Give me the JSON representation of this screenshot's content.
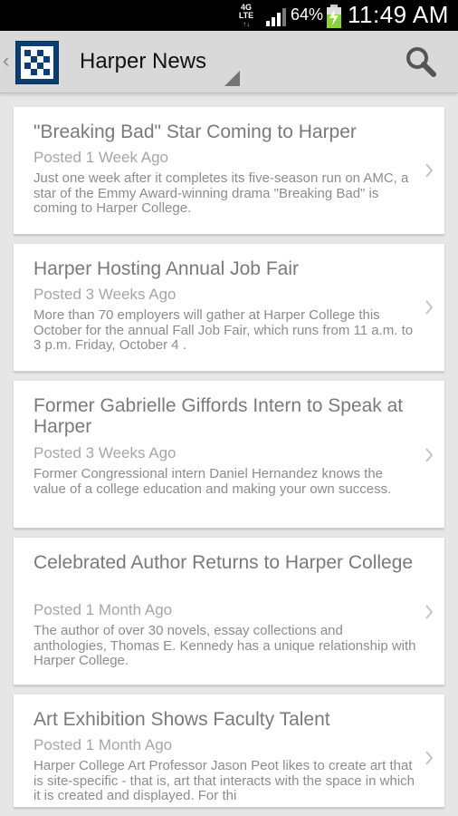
{
  "status_bar": {
    "network": "4G",
    "network_sub": "LTE",
    "battery_percent": "64%",
    "time": "11:49 AM"
  },
  "action_bar": {
    "title": "Harper News",
    "icons": {
      "up": "back-caret-icon",
      "logo": "harper-logo-icon",
      "search": "search-icon",
      "dropdown": "dropdown-triangle-icon"
    }
  },
  "articles": [
    {
      "title": "\"Breaking Bad\" Star Coming to Harper",
      "posted": "Posted 1 Week Ago",
      "summary": "Just one week after it completes its five-season run on AMC, a star of the Emmy Award-winning drama \"Breaking Bad\" is coming to Harper College."
    },
    {
      "title": "Harper Hosting Annual Job Fair",
      "posted": "Posted 3 Weeks Ago",
      "summary": "More than 70 employers will gather at Harper College this October for the annual Fall Job Fair, which runs from 11 a.m. to 3 p.m. Friday, October 4 ."
    },
    {
      "title": "Former Gabrielle Giffords Intern to Speak at Harper",
      "posted": "Posted 3 Weeks Ago",
      "summary": "Former Congressional intern Daniel Hernandez knows the value of a college education and making your own success."
    },
    {
      "title": "Celebrated Author Returns to Harper College",
      "posted": "Posted 1 Month Ago",
      "summary": "The author of over 30 novels, essay collections and anthologies, Thomas E. Kennedy has a unique relationship with Harper College."
    },
    {
      "title": "Art Exhibition Shows Faculty Talent",
      "posted": "Posted 1 Month Ago",
      "summary": "Harper College Art Professor Jason Peot likes to create art that is site-specific - that is, art that interacts with the space in which it is created and displayed. For thi"
    }
  ],
  "colors": {
    "status_bar": "#000000",
    "action_bar": "#d9d9d9",
    "background": "#e6e6e6",
    "logo_blue": "#0b3e73",
    "title_text": "#7a7a7a",
    "meta_text": "#a6a6a6",
    "battery_green": "#8ad43a"
  }
}
